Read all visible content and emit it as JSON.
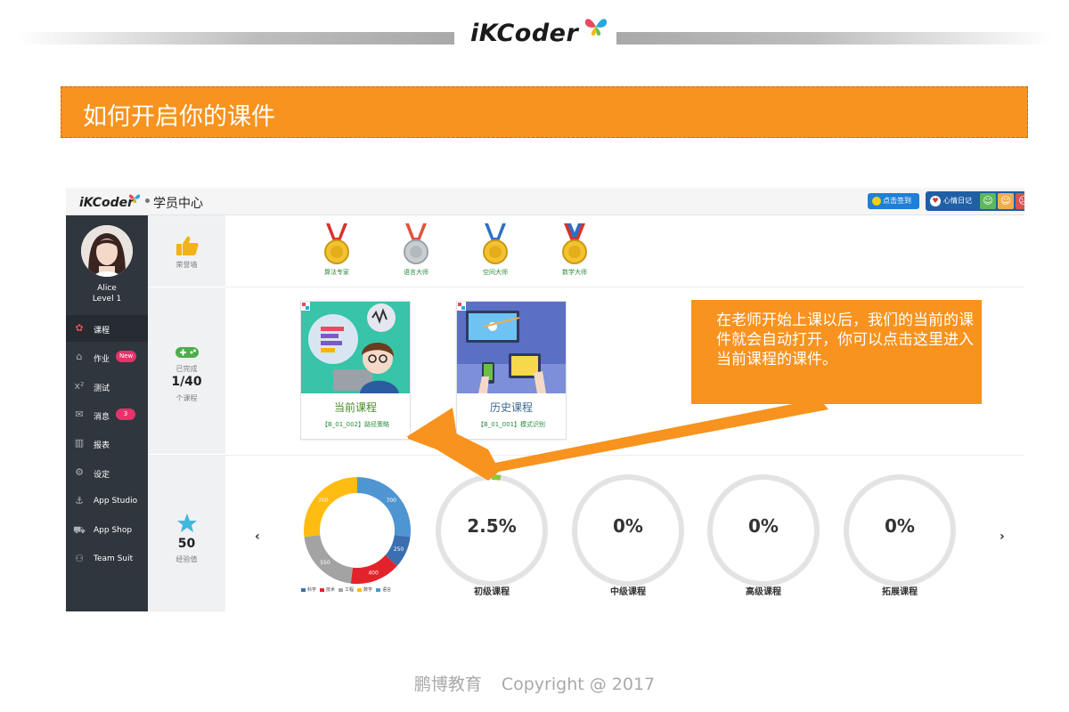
{
  "header": {
    "brand": "iKCoder"
  },
  "title": "如何开启你的课件",
  "app": {
    "logo": "iKCoder",
    "subtitle": "学员中心",
    "sign_in_label": "点击签到",
    "mood_label": "心情日记"
  },
  "user": {
    "name": "Alice",
    "level": "Level 1"
  },
  "sidebar": {
    "items": [
      {
        "label": "课程",
        "icon": "palette-icon",
        "active": true
      },
      {
        "label": "作业",
        "icon": "home-icon",
        "badge": "New"
      },
      {
        "label": "测试",
        "icon": "superscript-icon"
      },
      {
        "label": "消息",
        "icon": "mail-icon",
        "badge": "3"
      },
      {
        "label": "报表",
        "icon": "bar-chart-icon"
      },
      {
        "label": "设定",
        "icon": "gears-icon"
      },
      {
        "label": "App Studio",
        "icon": "anchor-icon"
      },
      {
        "label": "App Shop",
        "icon": "cart-icon"
      },
      {
        "label": "Team Suit",
        "icon": "team-icon"
      }
    ]
  },
  "stats": {
    "honor_label": "荣誉墙",
    "completed_label": "已完成",
    "completed_value": "1/40",
    "completed_unit": "个课程",
    "exp_value": "50",
    "exp_label": "经验值"
  },
  "medals": [
    {
      "label": "算法专家",
      "colors": {
        "ribbon": "#d9322e",
        "metal": "#f2c230"
      }
    },
    {
      "label": "语言大师",
      "colors": {
        "ribbon": "#e0533a",
        "metal": "#c9ced3"
      }
    },
    {
      "label": "空间大师",
      "colors": {
        "ribbon": "#2f6fc4",
        "metal": "#f2c230"
      }
    },
    {
      "label": "数学大师",
      "colors": {
        "ribbon": "#d9322e",
        "metal": "#f2c230"
      }
    }
  ],
  "courses": {
    "current": {
      "title": "当前课程",
      "code": "【B_01_002】路径策略"
    },
    "history": {
      "title": "历史课程",
      "code": "【B_01_001】模式识别"
    }
  },
  "chart_data": {
    "type": "pie",
    "categories": [
      "科学",
      "技术",
      "工程",
      "数学",
      "语言"
    ],
    "values": [
      250,
      400,
      550,
      700,
      700
    ],
    "colors": [
      "#3a6fb0",
      "#e3232c",
      "#a3a3a3",
      "#ffbc13",
      "#4f95d1"
    ]
  },
  "progress": [
    {
      "pct": "2.5%",
      "value": 2.5,
      "label": "初级课程"
    },
    {
      "pct": "0%",
      "value": 0,
      "label": "中级课程"
    },
    {
      "pct": "0%",
      "value": 0,
      "label": "高级课程"
    },
    {
      "pct": "0%",
      "value": 0,
      "label": "拓展课程"
    }
  ],
  "callout": "在老师开始上课以后，我们的当前的课件就会自动打开，你可以点击这里进入当前课程的课件。",
  "footer": {
    "org": "鹏博教育",
    "copyright": "Copyright @ 2017"
  },
  "accent": "#f7931e"
}
